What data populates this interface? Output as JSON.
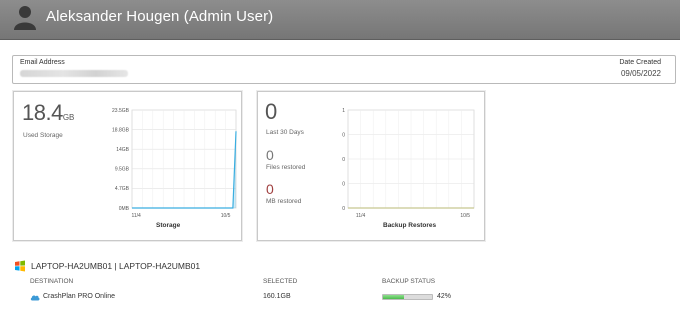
{
  "header": {
    "user_name": "Aleksander Hougen (Admin User)"
  },
  "user_info": {
    "email_label": "Email Address",
    "date_label": "Date Created",
    "date_value": "09/05/2022"
  },
  "storage_panel": {
    "value": "18.4",
    "unit": "GB",
    "caption": "Used Storage"
  },
  "restores_panel": {
    "value": "0",
    "value_caption": "Last 30 Days",
    "files_value": "0",
    "files_caption": "Files restored",
    "mb_value": "0",
    "mb_caption": "MB restored"
  },
  "chart_data": [
    {
      "type": "line",
      "title": "Storage",
      "x": [
        "11/4",
        "10/5"
      ],
      "y_ticks": [
        "23.5GB",
        "18.8GB",
        "14GB",
        "9.5GB",
        "4.7GB",
        "0MB"
      ],
      "ylim": [
        0,
        23.5
      ],
      "series": [
        {
          "values": [
            0,
            0,
            18.4
          ]
        }
      ],
      "grid": true
    },
    {
      "type": "line",
      "title": "Backup Restores",
      "x": [
        "11/4",
        "10/5"
      ],
      "y_ticks": [
        "1",
        "0",
        "0",
        "0",
        "0"
      ],
      "ylim": [
        0,
        1
      ],
      "series": [
        {
          "values": [
            0,
            0
          ]
        }
      ],
      "grid": true
    }
  ],
  "device": {
    "name": "LAPTOP-HA2UMB01 | LAPTOP-HA2UMB01",
    "icon": "windows-icon",
    "columns": {
      "destination": "DESTINATION",
      "selected": "SELECTED",
      "status": "BACKUP STATUS"
    },
    "rows": [
      {
        "destination": "CrashPlan PRO Online",
        "selected": "160.1GB",
        "progress": 42,
        "progress_label": "42%",
        "icon": "cloud-icon"
      }
    ]
  },
  "colors": {
    "header": "#808080",
    "progress": "#5cc45c",
    "chart_line": "#3aaee0",
    "restore_line": "#c8c890"
  }
}
